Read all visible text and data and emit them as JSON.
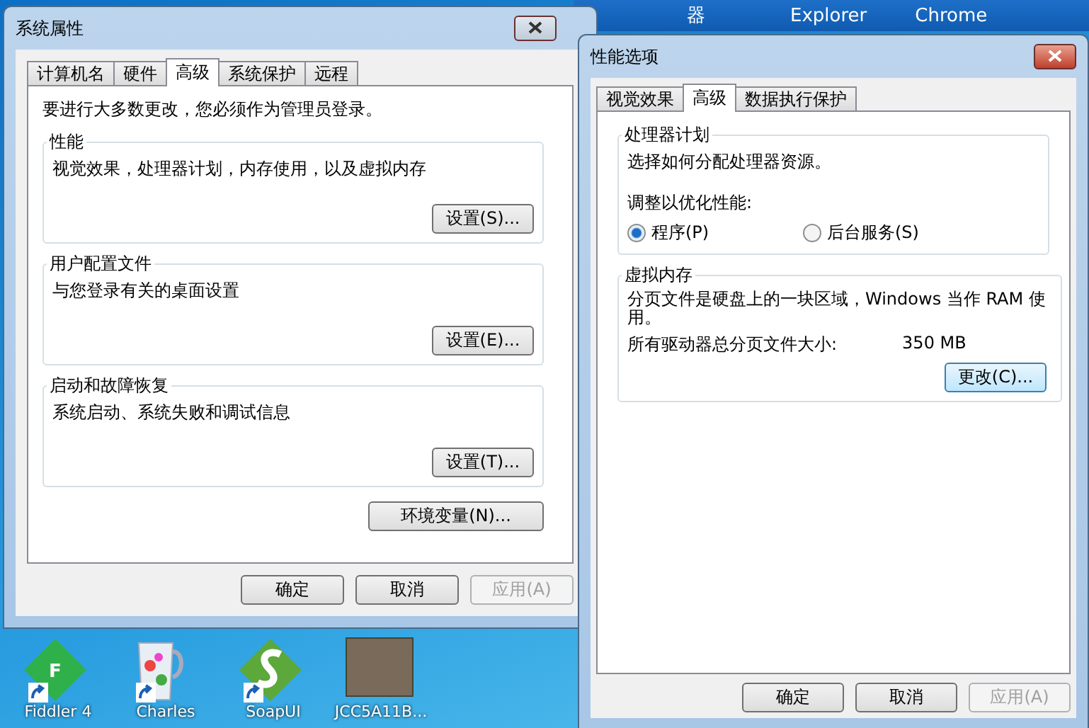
{
  "taskbar": {
    "items": [
      "器",
      "Explorer",
      "Chrome"
    ]
  },
  "desktop_icons": [
    {
      "label": "Fiddler 4",
      "kind": "fiddler",
      "shortcut": true,
      "letter": "F"
    },
    {
      "label": "Charles",
      "kind": "jug",
      "shortcut": true
    },
    {
      "label": "SoapUI",
      "kind": "soap",
      "shortcut": true
    },
    {
      "label": "JCC5A11B...",
      "kind": "photo",
      "shortcut": false
    }
  ],
  "system_properties": {
    "title": "系统属性",
    "tabs": [
      {
        "label": "计算机名",
        "selected": false
      },
      {
        "label": "硬件",
        "selected": false
      },
      {
        "label": "高级",
        "selected": true
      },
      {
        "label": "系统保护",
        "selected": false
      },
      {
        "label": "远程",
        "selected": false
      }
    ],
    "notice": "要进行大多数更改，您必须作为管理员登录。",
    "groups": [
      {
        "title": "性能",
        "description": "视觉效果，处理器计划，内存使用，以及虚拟内存",
        "button": "设置(S)..."
      },
      {
        "title": "用户配置文件",
        "description": "与您登录有关的桌面设置",
        "button": "设置(E)..."
      },
      {
        "title": "启动和故障恢复",
        "description": "系统启动、系统失败和调试信息",
        "button": "设置(T)..."
      }
    ],
    "env_button": "环境变量(N)...",
    "buttons": [
      {
        "label": "确定",
        "disabled": false
      },
      {
        "label": "取消",
        "disabled": false
      },
      {
        "label": "应用(A)",
        "disabled": true
      }
    ]
  },
  "performance_options": {
    "title": "性能选项",
    "tabs": [
      {
        "label": "视觉效果",
        "selected": false
      },
      {
        "label": "高级",
        "selected": true
      },
      {
        "label": "数据执行保护",
        "selected": false
      }
    ],
    "processor_group": {
      "title": "处理器计划",
      "description": "选择如何分配处理器资源。",
      "prompt": "调整以优化性能:",
      "options": [
        {
          "label": "程序(P)",
          "selected": true
        },
        {
          "label": "后台服务(S)",
          "selected": false
        }
      ]
    },
    "virtual_memory": {
      "title": "虚拟内存",
      "description": "分页文件是硬盘上的一块区域，Windows 当作 RAM 使用。",
      "total_label": "所有驱动器总分页文件大小:",
      "total_value": "350 MB",
      "button": "更改(C)..."
    },
    "buttons": [
      {
        "label": "确定",
        "disabled": false
      },
      {
        "label": "取消",
        "disabled": false
      },
      {
        "label": "应用(A)",
        "disabled": true
      }
    ]
  }
}
